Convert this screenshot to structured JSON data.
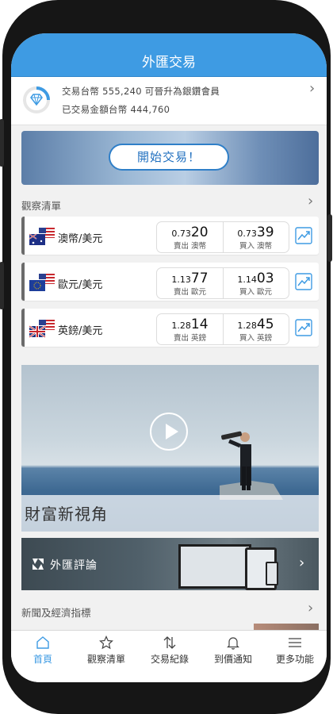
{
  "header": {
    "title": "外匯交易"
  },
  "member": {
    "line1": "交易台幣 555,240 可晉升為銀鑽會員",
    "line2": "已交易金額台幣 444,760"
  },
  "banner": {
    "cta_label": "開始交易！"
  },
  "watchlist": {
    "title": "觀察清單",
    "rows": [
      {
        "pair": "澳幣/美元",
        "sell_prefix": "0.73",
        "sell_big": "20",
        "sell_label": "賣出 澳幣",
        "buy_prefix": "0.73",
        "buy_big": "39",
        "buy_label": "買入 澳幣"
      },
      {
        "pair": "歐元/美元",
        "sell_prefix": "1.13",
        "sell_big": "77",
        "sell_label": "賣出 歐元",
        "buy_prefix": "1.14",
        "buy_big": "03",
        "buy_label": "買入 歐元"
      },
      {
        "pair": "英鎊/美元",
        "sell_prefix": "1.28",
        "sell_big": "14",
        "sell_label": "賣出 英鎊",
        "buy_prefix": "1.28",
        "buy_big": "45",
        "buy_label": "買入 英鎊"
      }
    ]
  },
  "video": {
    "caption": "財富新視角"
  },
  "fx_commentary": {
    "label": "外匯評論"
  },
  "news": {
    "title": "新聞及經濟指標"
  },
  "tabbar": {
    "items": [
      {
        "label": "首頁",
        "icon": "home-icon"
      },
      {
        "label": "觀察清單",
        "icon": "star-icon"
      },
      {
        "label": "交易紀錄",
        "icon": "arrows-icon"
      },
      {
        "label": "到價通知",
        "icon": "bell-icon"
      },
      {
        "label": "更多功能",
        "icon": "menu-icon"
      }
    ]
  },
  "colors": {
    "accent": "#3e9be3",
    "header_bg": "#3e9be3"
  }
}
